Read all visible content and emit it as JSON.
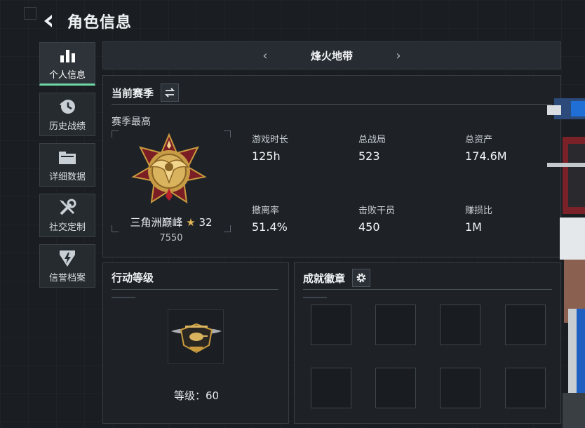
{
  "header": {
    "title": "角色信息",
    "back_icon": "back-arrow-icon"
  },
  "nav": {
    "items": [
      {
        "label": "个人信息",
        "icon": "bar-chart-icon",
        "active": true
      },
      {
        "label": "历史战绩",
        "icon": "history-clock-icon",
        "active": false
      },
      {
        "label": "详细数据",
        "icon": "folder-icon",
        "active": false
      },
      {
        "label": "社交定制",
        "icon": "tools-icon",
        "active": false
      },
      {
        "label": "信誉档案",
        "icon": "shield-bolt-icon",
        "active": false
      }
    ]
  },
  "mode_bar": {
    "prev": "‹",
    "title": "烽火地带",
    "next": "›"
  },
  "season": {
    "title": "当前赛季",
    "switch_icon": "swap-arrows-icon",
    "best_label": "赛季最高",
    "rank": {
      "name": "三角洲巅峰",
      "star": "★",
      "stars": "32",
      "score": "7550"
    },
    "stats": [
      {
        "label": "游戏时长",
        "value": "125h"
      },
      {
        "label": "总战局",
        "value": "523"
      },
      {
        "label": "总资产",
        "value": "174.6M"
      },
      {
        "label": "撤离率",
        "value": "51.4%"
      },
      {
        "label": "击败干员",
        "value": "450"
      },
      {
        "label": "赚损比",
        "value": "1M"
      }
    ]
  },
  "action_level": {
    "title": "行动等级",
    "level_text": "等级：60"
  },
  "achievements": {
    "title": "成就徽章",
    "settings_icon": "gear-icon",
    "slots": 8
  },
  "colors": {
    "accent": "#6fd7a6",
    "gold": "#e5b657",
    "background": "#1a1e22",
    "panel": "#1e2328"
  }
}
